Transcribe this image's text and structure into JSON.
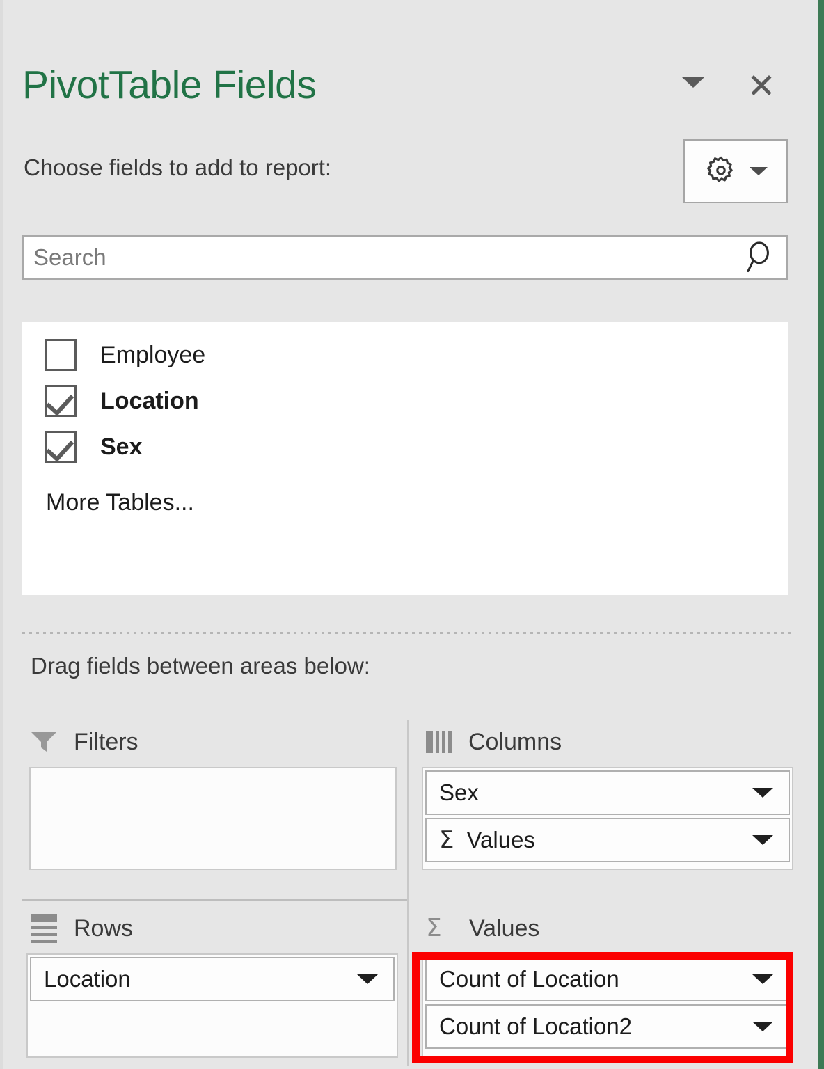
{
  "panel": {
    "title": "PivotTable Fields",
    "choose_label": "Choose fields to add to report:",
    "drag_label": "Drag fields between areas below:",
    "more_tables": "More Tables...",
    "title_color": "#217346",
    "accent_edge_color": "#3d7a55",
    "highlight_color": "#fb0000"
  },
  "header": {
    "menu_caret_icon": "chevron-down-icon",
    "close_icon": "close-icon",
    "tools_icon": "gear-icon",
    "tools_caret_icon": "chevron-down-icon"
  },
  "search": {
    "value": "",
    "placeholder": "Search",
    "icon": "search-icon"
  },
  "fields": [
    {
      "label": "Employee",
      "checked": false,
      "bold": false
    },
    {
      "label": "Location",
      "checked": true,
      "bold": true
    },
    {
      "label": "Sex",
      "checked": true,
      "bold": true
    }
  ],
  "areas": {
    "filters": {
      "title": "Filters",
      "icon": "filter-funnel-icon",
      "items": []
    },
    "columns": {
      "title": "Columns",
      "icon": "columns-icon",
      "items": [
        {
          "label": "Sex",
          "sigma": false,
          "caret_icon": "chevron-down-icon"
        },
        {
          "label": "Values",
          "sigma": true,
          "sigma_glyph": "Σ",
          "caret_icon": "chevron-down-icon"
        }
      ]
    },
    "rows": {
      "title": "Rows",
      "icon": "rows-icon",
      "items": [
        {
          "label": "Location",
          "sigma": false,
          "caret_icon": "chevron-down-icon"
        }
      ]
    },
    "values": {
      "title": "Values",
      "icon": "sigma-icon",
      "icon_glyph": "Σ",
      "highlighted": true,
      "items": [
        {
          "label": "Count of Location",
          "sigma": false,
          "caret_icon": "chevron-down-icon"
        },
        {
          "label": "Count of Location2",
          "sigma": false,
          "caret_icon": "chevron-down-icon"
        }
      ]
    }
  }
}
